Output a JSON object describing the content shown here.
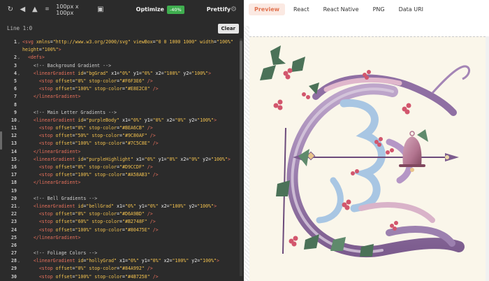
{
  "toolbar": {
    "refresh_icon": "refresh-icon",
    "flip_icon": "flip-icon",
    "flip_vertical_icon": "flip-vertical-icon",
    "crop_icon": "crop-icon",
    "size_label": "100px x 100px",
    "resize_icon": "resize-icon",
    "optimize_label": "Optimize",
    "optimize_badge": "-40%",
    "prettify_label": "Prettify",
    "settings_icon": "gear-icon"
  },
  "status": {
    "line_info": "Line 1:0",
    "clear_label": "Clear"
  },
  "code": {
    "lines": [
      {
        "n": "1",
        "fold": true,
        "text": "<svg xmlns=\"http://www.w3.org/2000/svg\" viewBox=\"0 0 1000 1000\" width=\"100%\""
      },
      {
        "n": "",
        "fold": false,
        "text": "height=\"100%\">"
      },
      {
        "n": "2",
        "fold": true,
        "text": "  <defs>"
      },
      {
        "n": "3",
        "fold": false,
        "text": "    <!-- Background Gradient -->"
      },
      {
        "n": "4",
        "fold": true,
        "text": "    <linearGradient id=\"bgGrad\" x1=\"0%\" y1=\"0%\" x2=\"100%\" y2=\"100%\">"
      },
      {
        "n": "5",
        "fold": false,
        "text": "      <stop offset=\"0%\" stop-color=\"#F6F3E6\" />"
      },
      {
        "n": "6",
        "fold": false,
        "text": "      <stop offset=\"100%\" stop-color=\"#E8E2C8\" />"
      },
      {
        "n": "7",
        "fold": false,
        "text": "    </linearGradient>"
      },
      {
        "n": "8",
        "fold": false,
        "text": ""
      },
      {
        "n": "9",
        "fold": false,
        "text": "    <!-- Main Letter Gradients -->"
      },
      {
        "n": "10",
        "fold": true,
        "text": "    <linearGradient id=\"purpleBody\" x1=\"0%\" y1=\"0%\" x2=\"0%\" y2=\"100%\">"
      },
      {
        "n": "11",
        "fold": false,
        "text": "      <stop offset=\"0%\" stop-color=\"#BEA6CB\" />"
      },
      {
        "n": "12",
        "fold": false,
        "text": "      <stop offset=\"50%\" stop-color=\"#9C80AF\" />"
      },
      {
        "n": "13",
        "fold": false,
        "text": "      <stop offset=\"100%\" stop-color=\"#7C5C8E\" />"
      },
      {
        "n": "14",
        "fold": false,
        "text": "    </linearGradient>"
      },
      {
        "n": "15",
        "fold": true,
        "text": "    <linearGradient id=\"purpleHighlight\" x1=\"0%\" y1=\"0%\" x2=\"0%\" y2=\"100%\">"
      },
      {
        "n": "16",
        "fold": false,
        "text": "      <stop offset=\"0%\" stop-color=\"#D9CCDF\" />"
      },
      {
        "n": "17",
        "fold": false,
        "text": "      <stop offset=\"100%\" stop-color=\"#A58AB3\" />"
      },
      {
        "n": "18",
        "fold": false,
        "text": "    </linearGradient>"
      },
      {
        "n": "19",
        "fold": false,
        "text": ""
      },
      {
        "n": "20",
        "fold": false,
        "text": "    <!-- Bell Gradients -->"
      },
      {
        "n": "21",
        "fold": true,
        "text": "    <linearGradient id=\"bellGrad\" x1=\"0%\" y1=\"0%\" x2=\"100%\" y2=\"100%\">"
      },
      {
        "n": "22",
        "fold": false,
        "text": "      <stop offset=\"0%\" stop-color=\"#D6A9BD\" />"
      },
      {
        "n": "23",
        "fold": false,
        "text": "      <stop offset=\"60%\" stop-color=\"#B2748F\" />"
      },
      {
        "n": "24",
        "fold": false,
        "text": "      <stop offset=\"100%\" stop-color=\"#80475E\" />"
      },
      {
        "n": "25",
        "fold": false,
        "text": "    </linearGradient>"
      },
      {
        "n": "26",
        "fold": false,
        "text": ""
      },
      {
        "n": "27",
        "fold": false,
        "text": "    <!-- Foliage Colors -->"
      },
      {
        "n": "28",
        "fold": true,
        "text": "    <linearGradient id=\"hollyGrad\" x1=\"0%\" y1=\"0%\" x2=\"100%\" y2=\"100%\">"
      },
      {
        "n": "29",
        "fold": false,
        "text": "      <stop offset=\"0%\" stop-color=\"#84A992\" />"
      },
      {
        "n": "30",
        "fold": false,
        "text": "      <stop offset=\"100%\" stop-color=\"#4B7258\" />"
      }
    ]
  },
  "preview_tabs": [
    {
      "label": "Preview",
      "active": true
    },
    {
      "label": "React",
      "active": false
    },
    {
      "label": "React Native",
      "active": false
    },
    {
      "label": "PNG",
      "active": false
    },
    {
      "label": "Data URI",
      "active": false
    }
  ],
  "colors": {
    "editor_bg": "#2b2b2b",
    "accent": "#e0724f",
    "optimize_badge": "#3fae4f",
    "preview_bg": "#faf6ea"
  }
}
